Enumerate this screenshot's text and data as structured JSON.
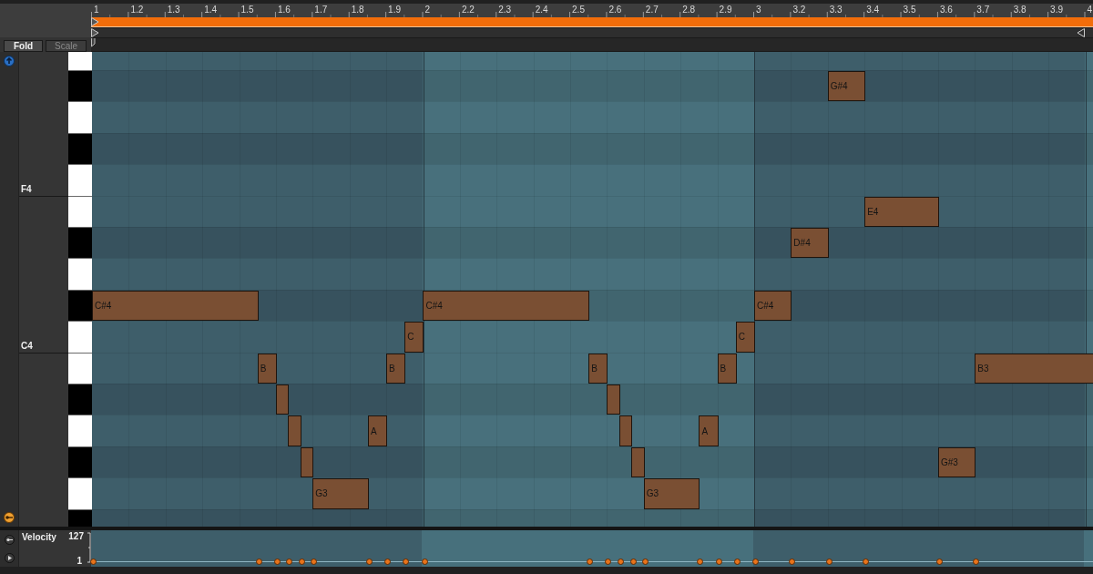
{
  "ruler": {
    "labels": [
      "1",
      "1.2",
      "1.3",
      "1.4",
      "1.5",
      "1.6",
      "1.7",
      "1.8",
      "1.9",
      "2",
      "2.2",
      "2.3",
      "2.4",
      "2.5",
      "2.6",
      "2.7",
      "2.8",
      "2.9",
      "3",
      "3.2",
      "3.3",
      "3.4",
      "3.5",
      "3.6",
      "3.7",
      "3.8",
      "3.9",
      "4"
    ]
  },
  "toolbar": {
    "buttons": [
      {
        "label": "Fold",
        "disabled": false
      },
      {
        "label": "Scale",
        "disabled": true
      }
    ]
  },
  "piano_roll": {
    "keys": [
      {
        "kind": "white"
      },
      {
        "kind": "black",
        "notes": [
          {
            "label": "G#4"
          }
        ]
      },
      {
        "kind": "white"
      },
      {
        "kind": "black"
      },
      {
        "kind": "white",
        "label": "F4"
      },
      {
        "kind": "white",
        "notes": [
          {
            "label": "E4"
          }
        ]
      },
      {
        "kind": "black",
        "notes": [
          {
            "label": "D#4"
          }
        ]
      },
      {
        "kind": "white"
      },
      {
        "kind": "black",
        "notes": [
          {
            "label": "C#4"
          },
          {
            "label": "C#4"
          },
          {
            "label": "C#4"
          }
        ]
      },
      {
        "kind": "white",
        "label": "C4",
        "notes": [
          {
            "label": "C"
          },
          {
            "label": "C"
          }
        ]
      },
      {
        "kind": "white",
        "notes": [
          {
            "label": "B"
          },
          {
            "label": "B"
          },
          {
            "label": "B"
          },
          {
            "label": "B"
          },
          {
            "label": "B3"
          }
        ]
      },
      {
        "kind": "black"
      },
      {
        "kind": "white",
        "notes": [
          {
            "label": "A"
          },
          {
            "label": "A"
          }
        ]
      },
      {
        "kind": "black",
        "notes": [
          {
            "label": "G#3"
          }
        ]
      },
      {
        "kind": "white",
        "notes": [
          {
            "label": "G3"
          },
          {
            "label": "G3"
          }
        ]
      },
      {
        "kind": "black"
      }
    ]
  },
  "velocity_lane": {
    "title": "Velocity",
    "max": "127",
    "min": "1"
  }
}
